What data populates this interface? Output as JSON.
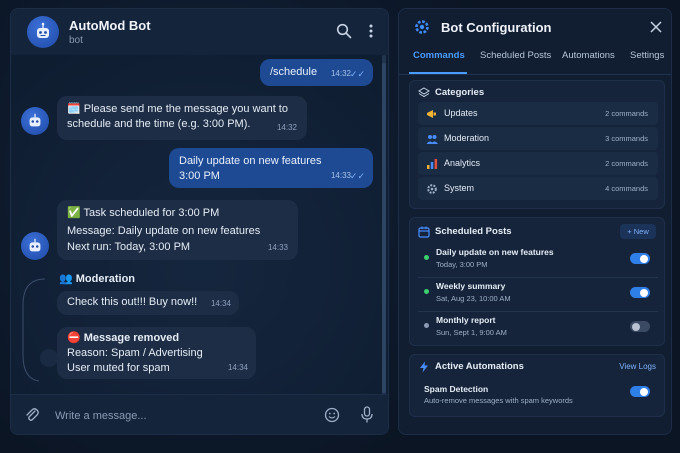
{
  "chat": {
    "header": {
      "title": "AutoMod Bot",
      "subtitle": "bot"
    },
    "messages": {
      "m1": {
        "text": "/schedule",
        "time": "14:32"
      },
      "m2": {
        "line1": "🗓️ Please send me the message you want to",
        "line2": "schedule and the time (e.g. 3:00 PM).",
        "time": "14:32"
      },
      "m3": {
        "line1": "Daily update on new features",
        "line2": "3:00 PM",
        "time": "14:33"
      },
      "m4": {
        "line1": "✅ Task scheduled for 3:00 PM",
        "line2": "Message: Daily update on new features",
        "line3": "Next run: Today, 3:00 PM",
        "time": "14:33"
      },
      "moderation_label": "👥 Moderation",
      "m5": {
        "text": "Check this out!!! Buy now!!",
        "time": "14:34"
      },
      "m6": {
        "line1": "⛔ Message removed",
        "line2": "Reason: Spam / Advertising",
        "line3": "User muted for spam",
        "time": "14:34"
      }
    },
    "input": {
      "placeholder": "Write a message..."
    }
  },
  "config": {
    "title": "Bot Configuration",
    "tabs": [
      "Commands",
      "Scheduled Posts",
      "Automations",
      "Settings"
    ],
    "active_tab": "Commands",
    "categories": {
      "title": "Categories",
      "items": [
        {
          "name": "Updates",
          "count": "2 commands"
        },
        {
          "name": "Moderation",
          "count": "3 commands"
        },
        {
          "name": "Analytics",
          "count": "2 commands"
        },
        {
          "name": "System",
          "count": "4 commands"
        }
      ]
    },
    "scheduled": {
      "title": "Scheduled Posts",
      "new_label": "+ New",
      "items": [
        {
          "name": "Daily update on new features",
          "when": "Today, 3:00 PM",
          "enabled": true,
          "dot": "#3ccf6e"
        },
        {
          "name": "Weekly summary",
          "when": "Sat, Aug 23, 10:00 AM",
          "enabled": true,
          "dot": "#3ccf6e"
        },
        {
          "name": "Monthly report",
          "when": "Sun, Sept 1, 9:00 AM",
          "enabled": false,
          "dot": "#8a9bb3"
        }
      ]
    },
    "automations": {
      "title": "Active Automations",
      "link": "View Logs",
      "items": [
        {
          "name": "Spam Detection",
          "desc": "Auto-remove messages with spam keywords",
          "enabled": true
        }
      ]
    }
  },
  "colors": {
    "accent": "#2f7fe8",
    "link": "#4a9bff",
    "outgoing_bubble": "#1d4a93",
    "incoming_bubble": "#1d2d45"
  }
}
